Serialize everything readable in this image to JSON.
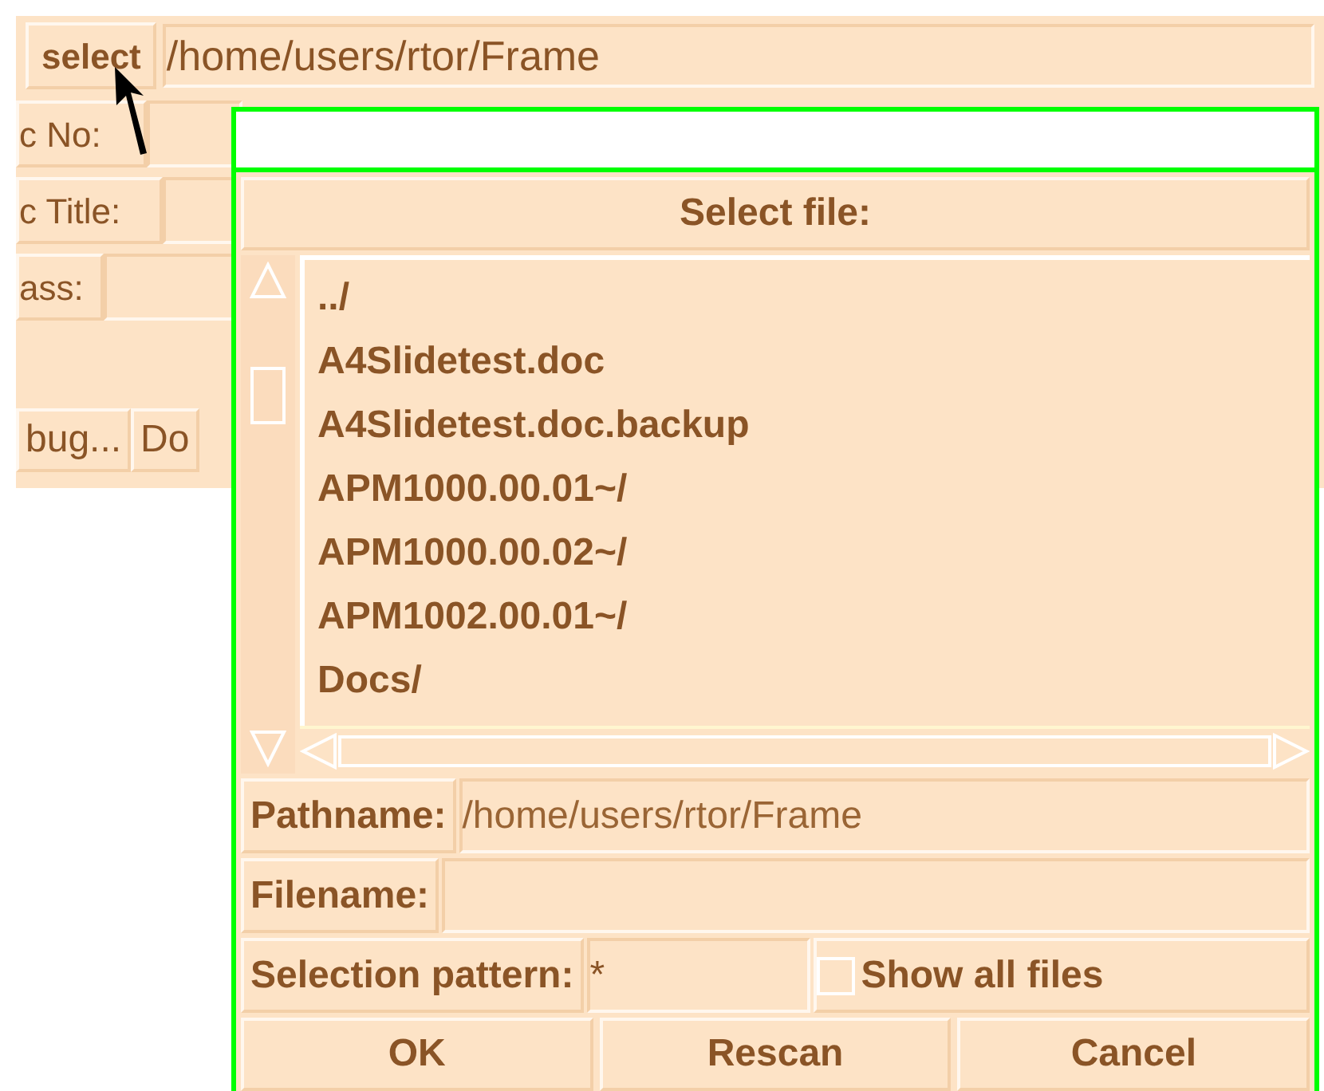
{
  "main": {
    "select_button": "select",
    "path": "/home/users/rtor/Frame",
    "fields": [
      {
        "label": "c No:"
      },
      {
        "label": "c Title:"
      },
      {
        "label": "ass:"
      }
    ],
    "buttons": [
      "bug...",
      "Do"
    ]
  },
  "dialog": {
    "heading": "Select file:",
    "files": [
      "../",
      "A4Slidetest.doc",
      "A4Slidetest.doc.backup",
      "APM1000.00.01~/",
      "APM1000.00.02~/",
      "APM1002.00.01~/",
      "Docs/"
    ],
    "pathname_label": "Pathname:",
    "pathname": "/home/users/rtor/Frame",
    "filename_label": "Filename:",
    "pattern_label": "Selection pattern:",
    "pattern": "*",
    "show_all": {
      "label": "Show all files",
      "checked": false
    },
    "buttons": [
      "OK",
      "Rescan",
      "Cancel"
    ]
  }
}
